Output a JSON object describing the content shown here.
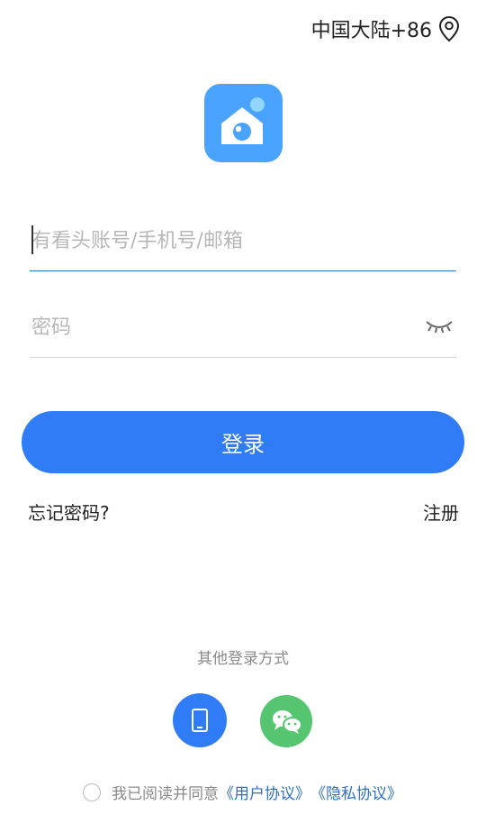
{
  "header": {
    "region_label": "中国大陆+86"
  },
  "form": {
    "account_placeholder": "有看头账号/手机号/邮箱",
    "password_placeholder": "密码",
    "login_button_label": "登录",
    "forgot_password_label": "忘记密码?",
    "register_label": "注册"
  },
  "other_login": {
    "title": "其他登录方式",
    "methods": [
      {
        "name": "phone-login",
        "icon": "tablet-icon"
      },
      {
        "name": "wechat-login",
        "icon": "wechat-icon"
      }
    ]
  },
  "agreement": {
    "text": "我已阅读并同意",
    "user_agreement": "《用户协议》",
    "privacy_agreement": "《隐私协议》"
  },
  "colors": {
    "primary": "#2f7cf6",
    "logo": "#4aa3ff",
    "wechat": "#55c66f",
    "link": "#2f6fc2"
  }
}
